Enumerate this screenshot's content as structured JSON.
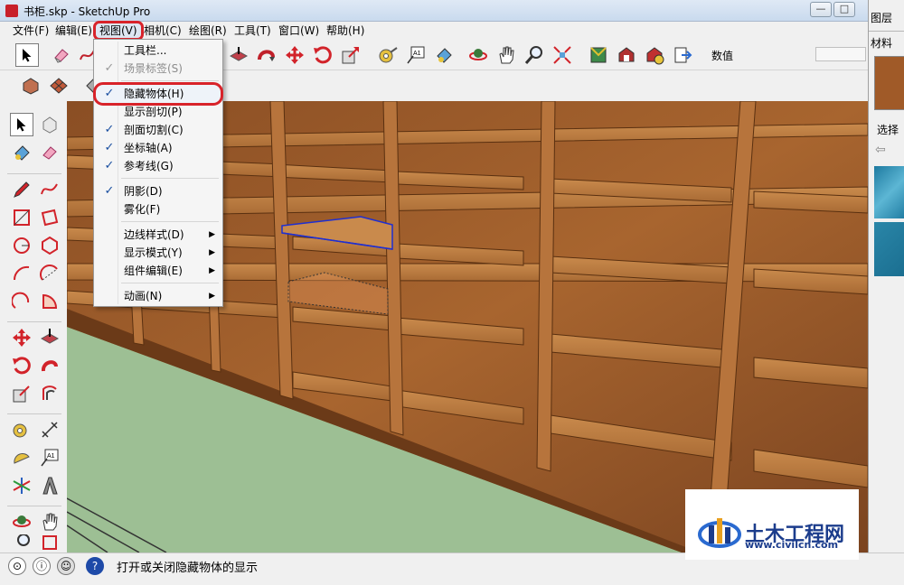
{
  "window": {
    "title": "书柜.skp - SketchUp Pro",
    "minimize_glyph": "—",
    "maximize_glyph": "□",
    "close_glyph": "✕"
  },
  "menubar": [
    {
      "label": "文件(F)"
    },
    {
      "label": "编辑(E)"
    },
    {
      "label": "视图(V)"
    },
    {
      "label": "相机(C)"
    },
    {
      "label": "绘图(R)"
    },
    {
      "label": "工具(T)"
    },
    {
      "label": "窗口(W)"
    },
    {
      "label": "帮助(H)"
    }
  ],
  "toolbar": {
    "value_label": "数值",
    "value_input": ""
  },
  "view_menu": {
    "items": [
      {
        "label": "工具栏...",
        "checked": false,
        "disabled": false,
        "submenu": false
      },
      {
        "label": "场景标签(S)",
        "checked": true,
        "disabled": true,
        "submenu": false
      },
      {
        "label": "隐藏物体(H)",
        "checked": true,
        "disabled": false,
        "submenu": false,
        "highlighted": true
      },
      {
        "label": "显示剖切(P)",
        "checked": false,
        "disabled": false,
        "submenu": false
      },
      {
        "label": "剖面切割(C)",
        "checked": true,
        "disabled": false,
        "submenu": false
      },
      {
        "label": "坐标轴(A)",
        "checked": true,
        "disabled": false,
        "submenu": false
      },
      {
        "label": "参考线(G)",
        "checked": true,
        "disabled": false,
        "submenu": false
      },
      {
        "label": "阴影(D)",
        "checked": true,
        "disabled": false,
        "submenu": false
      },
      {
        "label": "雾化(F)",
        "checked": false,
        "disabled": false,
        "submenu": false
      },
      {
        "label": "边线样式(D)",
        "checked": false,
        "disabled": false,
        "submenu": true
      },
      {
        "label": "显示模式(Y)",
        "checked": false,
        "disabled": false,
        "submenu": true
      },
      {
        "label": "组件编辑(E)",
        "checked": false,
        "disabled": false,
        "submenu": true
      },
      {
        "label": "动画(N)",
        "checked": false,
        "disabled": false,
        "submenu": true
      }
    ],
    "check_glyph": "✓",
    "submenu_glyph": "▶"
  },
  "right_panel": {
    "layers_tab": "图层",
    "materials_tab": "材料",
    "select_label": "选择"
  },
  "statusbar": {
    "text": "打开或关闭隐藏物体的显示"
  },
  "watermark": {
    "title": "土木工程网",
    "url": "www.civilcn.com"
  },
  "colors": {
    "highlight_red": "#d8232a",
    "wood": "#9a5a2a",
    "floor": "#9dbf94",
    "selection_blue": "#1f2fd0"
  },
  "icons": {
    "select": "arrow-cursor-icon",
    "eraser": "eraser-icon",
    "pencil": "pencil-icon",
    "paint": "paint-bucket-icon",
    "move": "move-icon",
    "rotate": "rotate-icon",
    "orbit": "orbit-icon",
    "zoom": "zoom-icon"
  }
}
